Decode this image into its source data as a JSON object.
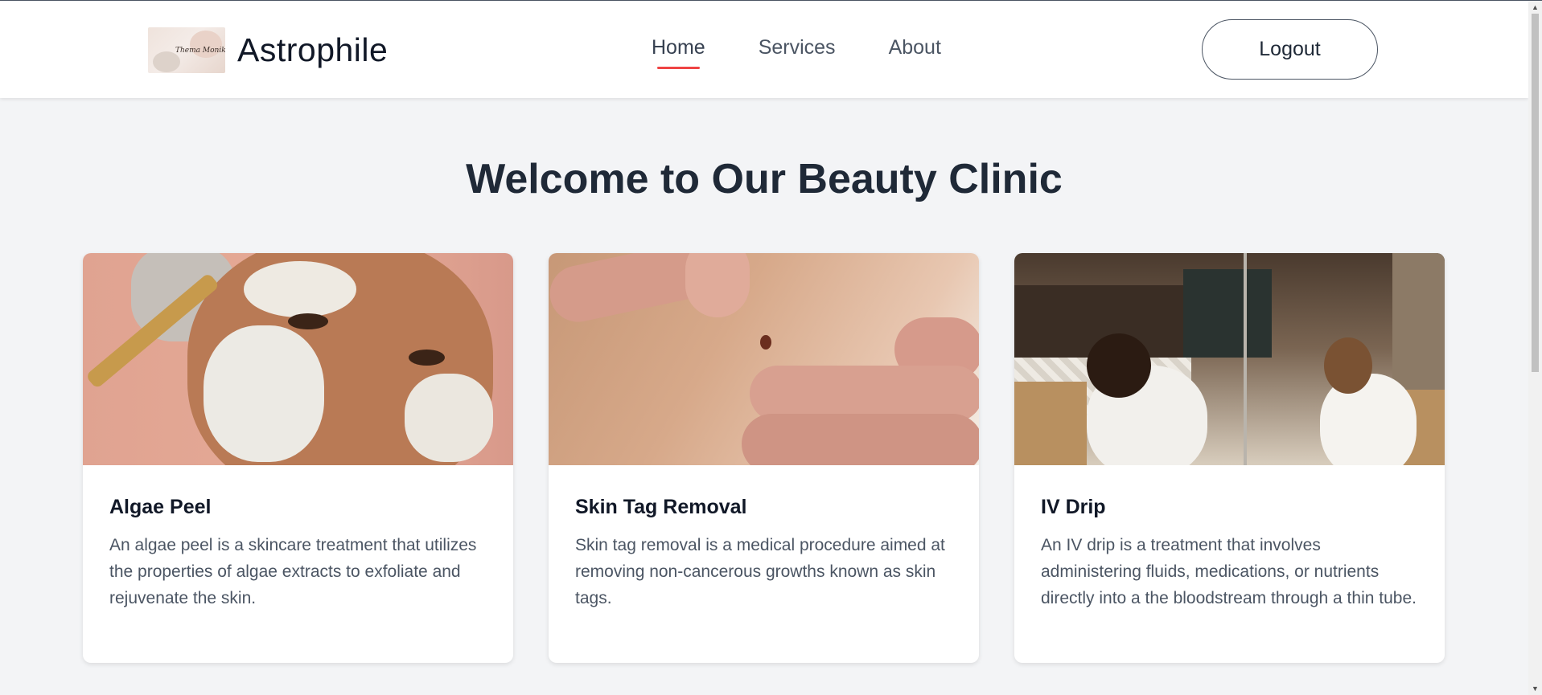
{
  "brand": {
    "logo_text": "Thema Monika",
    "name": "Astrophile"
  },
  "nav": {
    "items": [
      {
        "label": "Home",
        "active": true
      },
      {
        "label": "Services",
        "active": false
      },
      {
        "label": "About",
        "active": false
      }
    ],
    "logout_label": "Logout",
    "active_underline_color": "#ef4444"
  },
  "main": {
    "title": "Welcome to Our Beauty Clinic",
    "cards": [
      {
        "title": "Algae Peel",
        "description": "An algae peel is a skincare treatment that utilizes the properties of algae extracts to exfoliate and rejuvenate the skin.",
        "image_alt": "Woman with algae peel mask applied by brush"
      },
      {
        "title": "Skin Tag Removal",
        "description": "Skin tag removal is a medical procedure aimed at removing non-cancerous growths known as skin tags.",
        "image_alt": "Fingers examining a mole on skin"
      },
      {
        "title": "IV Drip",
        "description": "An IV drip is a treatment that involves administering fluids, medications, or nutrients directly into a the bloodstream through a thin tube.",
        "image_alt": "Two women in robes receiving IV drips in a lounge"
      }
    ]
  },
  "scrollbar": {
    "up_arrow": "▲",
    "down_arrow": "▼"
  }
}
